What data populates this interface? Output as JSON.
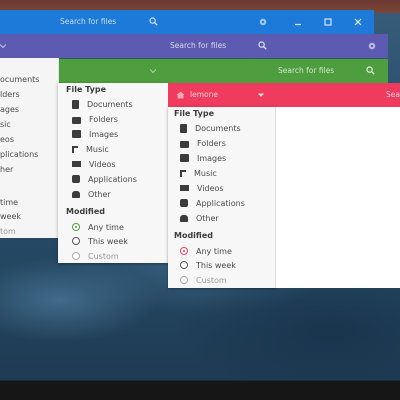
{
  "colors": {
    "blue": "#1d7ad8",
    "purple": "#5d5bb1",
    "green": "#4e9d3e",
    "pink": "#ee3b5e"
  },
  "blue_window": {
    "search": "Search for files"
  },
  "purple_window": {
    "search": "Search for files"
  },
  "green_window": {
    "search": "Search for files"
  },
  "pink_window": {
    "location": "lemone",
    "search": "Sea"
  },
  "sidebar": {
    "file_type_heading": "File Type",
    "file_types": [
      "Documents",
      "Folders",
      "Images",
      "Music",
      "Videos",
      "Applications",
      "Other"
    ],
    "modified_heading": "Modified",
    "modified": [
      "Any time",
      "This week",
      "Custom"
    ]
  },
  "clipped_sidebar": {
    "file_types": [
      "ocuments",
      "lders",
      "ages",
      "sic",
      "eos",
      "plications",
      "her"
    ],
    "modified": [
      "time",
      "week",
      "tom"
    ]
  }
}
